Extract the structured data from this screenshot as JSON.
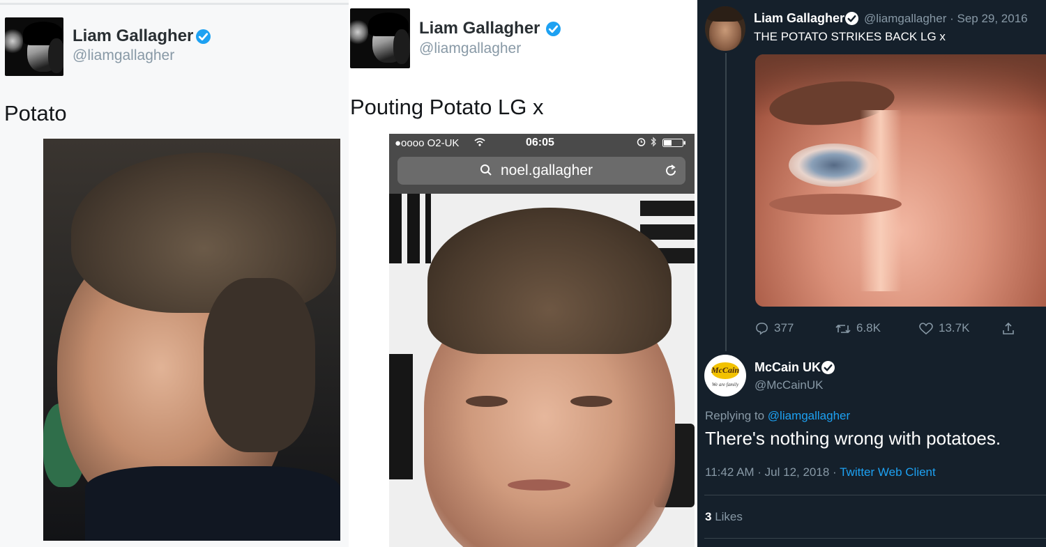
{
  "panel1": {
    "author": {
      "name": "Liam Gallagher",
      "handle": "@liamgallagher"
    },
    "text": "Potato",
    "icons": [
      "verified-badge-icon"
    ]
  },
  "panel2": {
    "author": {
      "name": "Liam Gallagher",
      "handle": "@liamgallagher"
    },
    "text": "Pouting Potato LG x",
    "phone": {
      "carrier": "●oooo O2-UK",
      "time": "06:05",
      "url": "noel.gallagher",
      "icons": [
        "wifi-icon",
        "alarm-icon",
        "bluetooth-icon",
        "battery-icon",
        "search-icon",
        "reload-icon"
      ]
    }
  },
  "panel3": {
    "tweet": {
      "name": "Liam Gallagher",
      "meta": "@liamgallagher · Sep 29, 2016",
      "text": "THE POTATO STRIKES BACK LG x",
      "stats": {
        "replies": "377",
        "retweets": "6.8K",
        "likes": "13.7K"
      }
    },
    "reply": {
      "name": "McCain UK",
      "handle": "@McCainUK",
      "logo_text": "McCain",
      "logo_tagline": "We are family",
      "replying_prefix": "Replying to",
      "replying_to": "@liamgallagher",
      "text": "There's nothing wrong with potatoes.",
      "timestamp": "11:42 AM · Jul 12, 2018 ·",
      "client": "Twitter Web Client",
      "likes_count": "3",
      "likes_label": "Likes"
    }
  },
  "colors": {
    "twitter_blue": "#1da1f2",
    "dark_bg": "#15202b",
    "muted": "#8899a6"
  }
}
